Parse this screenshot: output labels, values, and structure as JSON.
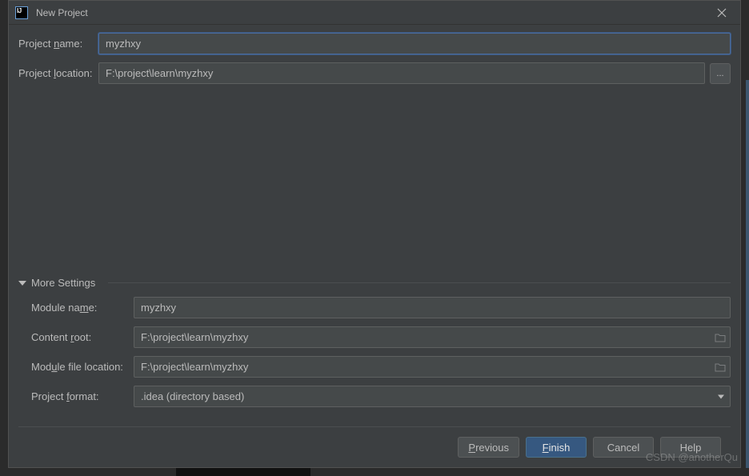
{
  "window": {
    "title": "New Project"
  },
  "labels": {
    "project_name": "Project name:",
    "project_location": "Project location:",
    "more_settings": "More Settings",
    "module_name": "Module name:",
    "content_root": "Content root:",
    "module_file_location": "Module file location:",
    "project_format": "Project format:"
  },
  "values": {
    "project_name": "myzhxy",
    "project_location": "F:\\project\\learn\\myzhxy",
    "module_name": "myzhxy",
    "content_root": "F:\\project\\learn\\myzhxy",
    "module_file_location": "F:\\project\\learn\\myzhxy",
    "project_format": ".idea (directory based)"
  },
  "buttons": {
    "previous": "Previous",
    "finish": "Finish",
    "cancel": "Cancel",
    "help": "Help",
    "browse": "..."
  },
  "watermark": "CSDN @anotherQu"
}
